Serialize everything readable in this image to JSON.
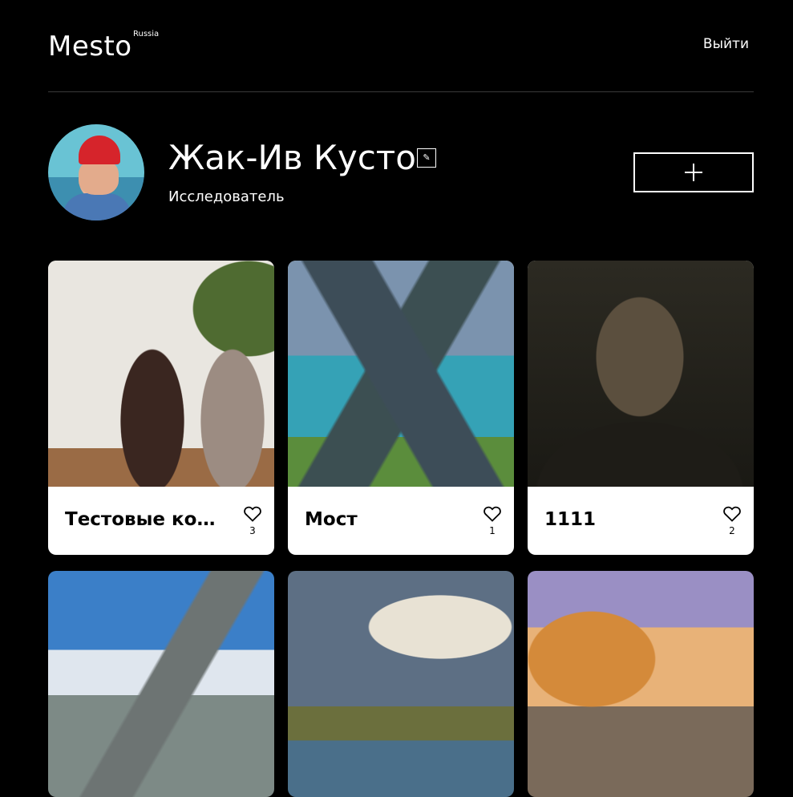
{
  "header": {
    "logo": "Mesto",
    "logo_sup": "Russia",
    "logout": "Выйти"
  },
  "profile": {
    "name": "Жак-Ив Кусто",
    "about": "Исследователь",
    "edit_icon": "pencil-icon",
    "add_icon": "plus-icon"
  },
  "cards": [
    {
      "title": "Тестовые кошки",
      "likes": "3",
      "image": "cats-photo"
    },
    {
      "title": "Мост",
      "likes": "1",
      "image": "lake-pier-photo"
    },
    {
      "title": "1111",
      "likes": "2",
      "image": "man-portrait-photo"
    },
    {
      "title": "",
      "likes": "",
      "image": "mountain-photo"
    },
    {
      "title": "",
      "likes": "",
      "image": "rainbow-lake-photo"
    },
    {
      "title": "",
      "likes": "",
      "image": "sunset-lake-photo"
    }
  ],
  "colors": {
    "background": "#000000",
    "card": "#ffffff",
    "text_light": "#ffffff",
    "text_dark": "#000000"
  }
}
